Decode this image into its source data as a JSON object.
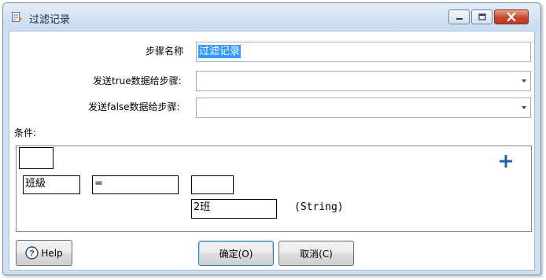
{
  "window": {
    "title": "过滤记录",
    "accent_close": "#c8462b"
  },
  "form": {
    "step_name_label": "步骤名称",
    "step_name_value": "过滤记录",
    "send_true_label": "发送true数据给步骤:",
    "send_true_value": "",
    "send_false_label": "发送false数据给步骤:",
    "send_false_value": ""
  },
  "condition": {
    "label": "条件:",
    "field": "班級",
    "operator": "=",
    "compare_field": "",
    "value": "2班",
    "value_type": "(String)"
  },
  "buttons": {
    "help": "Help",
    "ok": "确定(O)",
    "cancel": "取消(C)"
  }
}
